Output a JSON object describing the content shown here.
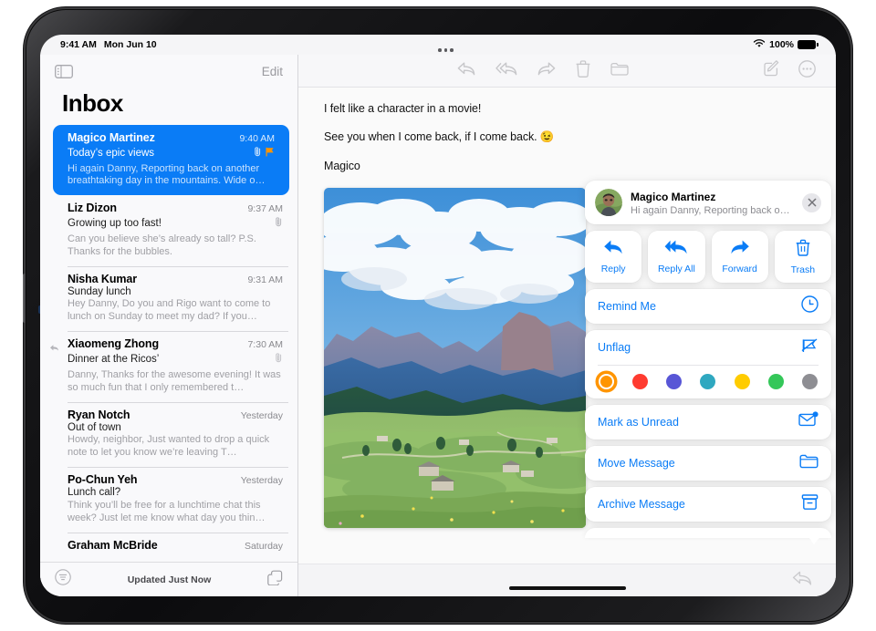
{
  "status_bar": {
    "time": "9:41 AM",
    "date": "Mon Jun 10",
    "wifi_icon": "wifi-icon",
    "battery_percent": "100%",
    "battery_icon": "battery-full-icon"
  },
  "multitask_handle": {
    "icon": "multitask-ellipsis-icon"
  },
  "sidebar": {
    "toggle_icon": "sidebar-toggle-icon",
    "edit_label": "Edit",
    "title": "Inbox",
    "bottom_bar": {
      "filter_icon": "filter-icon",
      "status_text": "Updated Just Now",
      "compose_icon": "new-message-icon"
    },
    "messages": [
      {
        "sender": "Magico Martinez",
        "time": "9:40 AM",
        "subject": "Today’s epic views",
        "preview": "Hi again Danny, Reporting back on another breathtaking day in the mountains. Wide o…",
        "selected": true,
        "has_attachment": true,
        "flagged": true,
        "flag_color": "#FF9500",
        "replied": false
      },
      {
        "sender": "Liz Dizon",
        "time": "9:37 AM",
        "subject": "Growing up too fast!",
        "preview": "Can you believe she’s already so tall? P.S. Thanks for the bubbles.",
        "selected": false,
        "has_attachment": true,
        "flagged": false,
        "replied": false
      },
      {
        "sender": "Nisha Kumar",
        "time": "9:31 AM",
        "subject": "Sunday lunch",
        "preview": "Hey Danny, Do you and Rigo want to come to lunch on Sunday to meet my dad? If you…",
        "selected": false,
        "has_attachment": false,
        "flagged": false,
        "replied": false
      },
      {
        "sender": "Xiaomeng Zhong",
        "time": "7:30 AM",
        "subject": "Dinner at the Ricos’",
        "preview": "Danny, Thanks for the awesome evening! It was so much fun that I only remembered t…",
        "selected": false,
        "has_attachment": true,
        "flagged": false,
        "replied": true
      },
      {
        "sender": "Ryan Notch",
        "time": "Yesterday",
        "subject": "Out of town",
        "preview": "Howdy, neighbor, Just wanted to drop a quick note to let you know we’re leaving T…",
        "selected": false,
        "has_attachment": false,
        "flagged": false,
        "replied": false
      },
      {
        "sender": "Po-Chun Yeh",
        "time": "Yesterday",
        "subject": "Lunch call?",
        "preview": "Think you’ll be free for a lunchtime chat this week? Just let me know what day you thin…",
        "selected": false,
        "has_attachment": false,
        "flagged": false,
        "replied": false
      },
      {
        "sender": "Graham McBride",
        "time": "Saturday",
        "subject": "",
        "preview": "",
        "selected": false,
        "has_attachment": false,
        "flagged": false,
        "replied": false
      }
    ]
  },
  "message_pane": {
    "toolbar": {
      "reply_icon": "reply-icon",
      "reply_all_icon": "reply-all-icon",
      "forward_icon": "forward-icon",
      "trash_icon": "trash-icon",
      "move_icon": "folder-icon",
      "compose_icon": "compose-icon",
      "more_icon": "more-ellipsis-circle-icon"
    },
    "body": {
      "paragraphs": [
        "I felt like a character in a movie!",
        "See you when I come back, if I come back. 😉",
        "Magico"
      ],
      "attachment_name": "mountain-landscape-photo"
    },
    "bottom_bar": {
      "reply_icon": "reply-icon"
    }
  },
  "action_popover": {
    "sender": "Magico Martinez",
    "preview": "Hi again Danny, Reporting back o…",
    "avatar_name": "sender-avatar",
    "close_icon": "close-icon",
    "quick_actions": [
      {
        "label": "Reply",
        "icon": "reply-icon"
      },
      {
        "label": "Reply All",
        "icon": "reply-all-icon"
      },
      {
        "label": "Forward",
        "icon": "forward-icon"
      },
      {
        "label": "Trash",
        "icon": "trash-icon"
      }
    ],
    "remind_me": {
      "label": "Remind Me",
      "icon": "clock-icon"
    },
    "flag": {
      "label": "Unflag",
      "icon": "flag-slash-icon"
    },
    "flag_colors": [
      {
        "name": "orange",
        "hex": "#FF9500",
        "selected": true
      },
      {
        "name": "red",
        "hex": "#FF3B30",
        "selected": false
      },
      {
        "name": "purple",
        "hex": "#5856D6",
        "selected": false
      },
      {
        "name": "teal",
        "hex": "#2FA8C0",
        "selected": false
      },
      {
        "name": "yellow",
        "hex": "#FFCC00",
        "selected": false
      },
      {
        "name": "green",
        "hex": "#34C759",
        "selected": false
      },
      {
        "name": "gray",
        "hex": "#8E8E93",
        "selected": false
      }
    ],
    "mark_unread": {
      "label": "Mark as Unread",
      "icon": "envelope-badge-icon"
    },
    "move_message": {
      "label": "Move Message",
      "icon": "folder-icon"
    },
    "archive_message": {
      "label": "Archive Message",
      "icon": "archivebox-icon"
    }
  },
  "theme": {
    "accent": "#0A7CF6",
    "selected_row_bg": "#0A7CF6",
    "flag_orange": "#FF9500"
  }
}
